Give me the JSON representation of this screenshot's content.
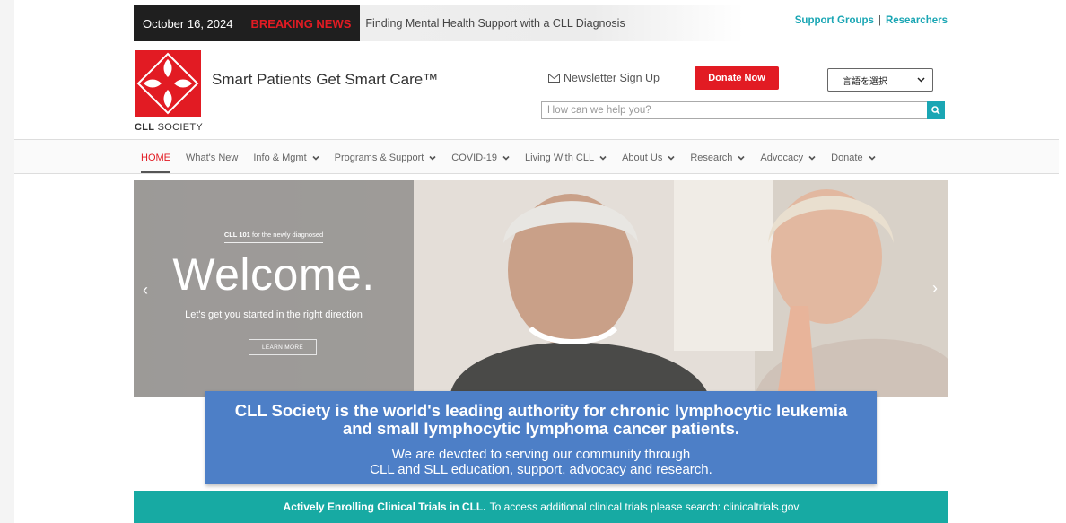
{
  "topbar": {
    "date": "October 16, 2024",
    "breaking_label": "BREAKING NEWS",
    "headline": "Finding Mental Health Support with a CLL Diagnosis",
    "links": [
      "Support Groups",
      "Researchers"
    ],
    "separator": "|"
  },
  "header": {
    "logo_text_bold": "CLL",
    "logo_text": "SOCIETY",
    "tagline": "Smart Patients Get Smart Care™",
    "newsletter_label": "Newsletter Sign Up",
    "donate_label": "Donate Now",
    "language_select_value": "言語を選択",
    "search_placeholder": "How can we help you?"
  },
  "nav": {
    "items": [
      {
        "label": "HOME",
        "dropdown": false,
        "active": true
      },
      {
        "label": "What's New",
        "dropdown": false,
        "active": false
      },
      {
        "label": "Info & Mgmt",
        "dropdown": true,
        "active": false
      },
      {
        "label": "Programs & Support",
        "dropdown": true,
        "active": false
      },
      {
        "label": "COVID-19",
        "dropdown": true,
        "active": false
      },
      {
        "label": "Living With CLL",
        "dropdown": true,
        "active": false
      },
      {
        "label": "About Us",
        "dropdown": true,
        "active": false
      },
      {
        "label": "Research",
        "dropdown": true,
        "active": false
      },
      {
        "label": "Advocacy",
        "dropdown": true,
        "active": false
      },
      {
        "label": "Donate",
        "dropdown": true,
        "active": false
      }
    ]
  },
  "hero": {
    "kicker_bold": "CLL 101",
    "kicker": "for the newly diagnosed",
    "title": "Welcome.",
    "subtitle": "Let's get you started in the right direction",
    "cta_label": "LEARN MORE",
    "prev_label": "‹",
    "next_label": "›"
  },
  "mission": {
    "headline_line1": "CLL Society is the world's leading authority for chronic lymphocytic leukemia",
    "headline_line2": "and small lymphocytic lymphoma cancer patients.",
    "body_line1": "We are devoted to serving our community through",
    "body_line2": "CLL and SLL education, support, advocacy and research."
  },
  "trials": {
    "bold": "Actively Enrolling Clinical Trials in CLL.",
    "text": "To access additional clinical trials please search: clinicaltrials.gov"
  },
  "colors": {
    "brand_red": "#e21b23",
    "teal": "#1aa6b4",
    "mission_blue": "#4d7fc7",
    "trials_teal": "#17aaa3"
  }
}
